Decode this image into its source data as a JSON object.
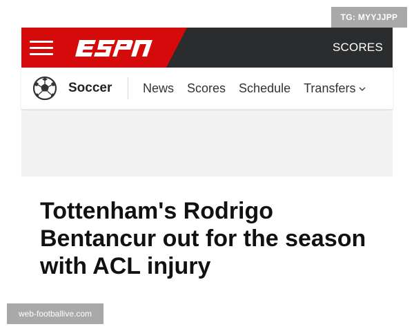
{
  "watermarks": {
    "top": "TG: MYYJJPP",
    "bottom": "web-footballive.com"
  },
  "header": {
    "brand_logo_text": "ESPN",
    "scores_link": "SCORES",
    "colors": {
      "bar_background": "#2b2c2d",
      "brand_red": "#d50a0a",
      "text": "#ffffff"
    }
  },
  "subnav": {
    "section_icon": "soccer-ball-icon",
    "section_label": "Soccer",
    "links": [
      "News",
      "Scores",
      "Schedule",
      "Transfers"
    ],
    "dropdown_icon": "chevron-down-icon"
  },
  "article": {
    "headline": "Tottenham's Rodrigo Bentancur out for the season with ACL injury"
  }
}
